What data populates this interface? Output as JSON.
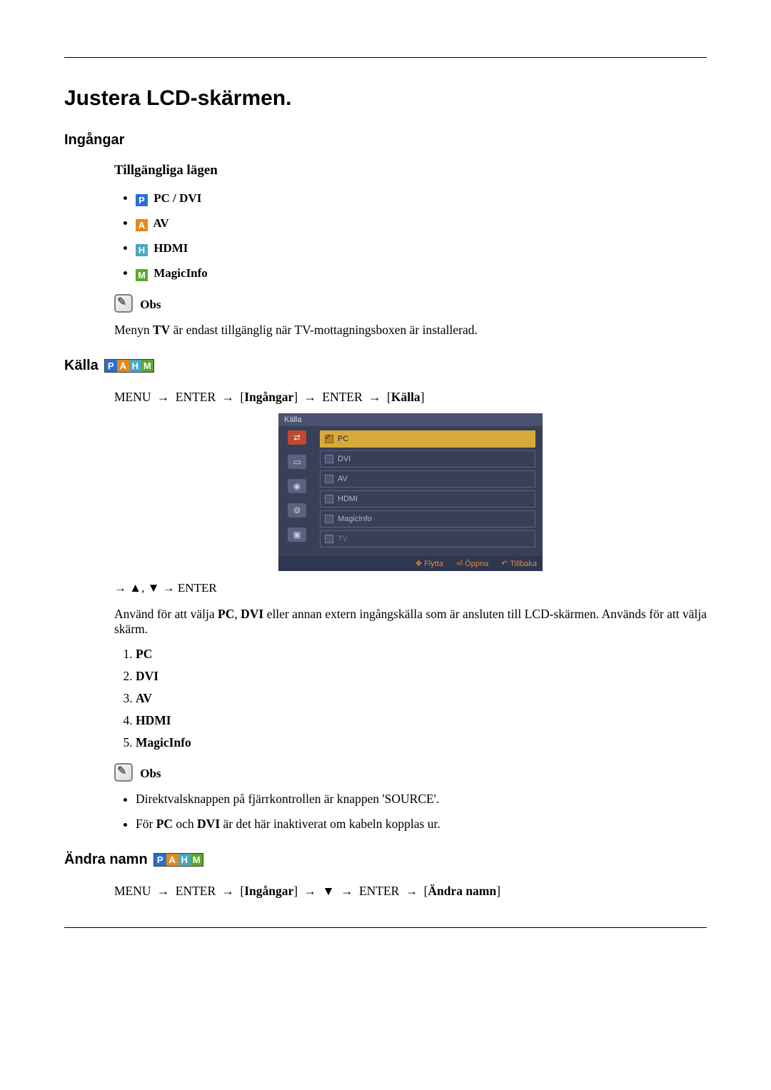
{
  "title": "Justera LCD-skärmen.",
  "section_ingangar": "Ingångar",
  "modes_heading": "Tillgängliga lägen",
  "modes": {
    "pc_dvi": "PC / DVI",
    "av": "AV",
    "hdmi": "HDMI",
    "magicinfo": "MagicInfo"
  },
  "badges": {
    "P": "P",
    "A": "A",
    "H": "H",
    "M": "M"
  },
  "obs_label": "Obs",
  "obs_text_1_pre": "Menyn ",
  "obs_text_1_tv": "TV",
  "obs_text_1_post": " är endast tillgänglig när TV-mottagningsboxen är installerad.",
  "section_kalla": "Källa",
  "nav1": {
    "menu": "MENU",
    "arrow": "→",
    "enter": "ENTER",
    "ing": "Ingångar",
    "kalla": "Källa",
    "lb": "[",
    "rb": "]"
  },
  "osd": {
    "title": "Källa",
    "items": {
      "pc": "PC",
      "dvi": "DVI",
      "av": "AV",
      "hdmi": "HDMI",
      "magicinfo": "MagicInfo",
      "tv": "TV"
    },
    "footer": {
      "flytta": "Flytta",
      "oppna": "Öppna",
      "tillbaka": "Tillbaka"
    }
  },
  "arrows_line": {
    "arrow": "→",
    "up": "▲",
    "comma": ", ",
    "down": "▼",
    "enter": "ENTER"
  },
  "kalla_desc_pre": "Använd för att välja ",
  "kalla_desc_pc": "PC",
  "kalla_desc_mid1": ", ",
  "kalla_desc_dvi": "DVI",
  "kalla_desc_post": " eller annan extern ingångskälla som är ansluten till LCD-skärmen. Används för att välja skärm.",
  "src_list": {
    "1": "PC",
    "2": "DVI",
    "3": "AV",
    "4": "HDMI",
    "5": "MagicInfo"
  },
  "notes2": {
    "a": "Direktvalsknappen på fjärrkontrollen är knappen 'SOURCE'.",
    "b_pre": "För ",
    "b_pc": "PC",
    "b_mid": " och ",
    "b_dvi": "DVI",
    "b_post": " är det här inaktiverat om kabeln kopplas ur."
  },
  "section_andra": "Ändra namn",
  "nav2": {
    "menu": "MENU",
    "arrow": "→",
    "enter": "ENTER",
    "ing": "Ingångar",
    "down": "▼",
    "andra": "Ändra namn",
    "lb": "[",
    "rb": "]"
  }
}
